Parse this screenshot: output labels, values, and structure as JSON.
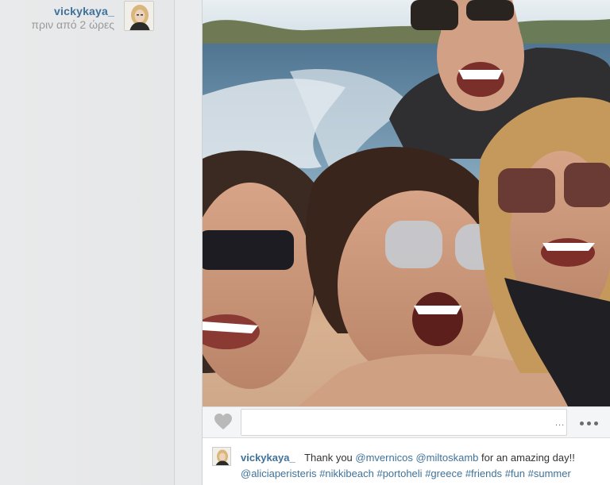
{
  "post": {
    "username": "vickykaya_",
    "timestamp": "πριν από 2 ώρες"
  },
  "actions": {
    "like_icon": "heart-icon",
    "more_icon": "more-dots-icon",
    "input_ellipsis": "..."
  },
  "caption": {
    "username": "vickykaya_",
    "text_start": "Thank you",
    "mentions": [
      "@mvernicos",
      "@miltoskamb",
      "@aliciaperisteris"
    ],
    "text_mid": "for an amazing day!!",
    "hashtags": [
      "#nikkibeach",
      "#portoheli",
      "#greece",
      "#friends",
      "#fun",
      "#summer"
    ]
  },
  "colors": {
    "link": "#3f729b",
    "muted": "#999999",
    "background": "#e8e9ea"
  }
}
